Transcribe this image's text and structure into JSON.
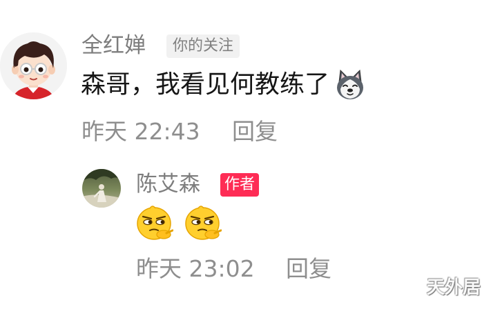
{
  "main_comment": {
    "username": "全红婵",
    "badge": "你的关注",
    "text": "森哥，我看见何教练了",
    "emoji_icon": "husky-dog-emoji-icon",
    "time": "昨天 22:43",
    "reply_label": "回复"
  },
  "reply_comment": {
    "username": "陈艾森",
    "badge": "作者",
    "emoji_icons": [
      "smug-face-emoji-icon",
      "smug-face-emoji-icon"
    ],
    "time": "昨天 23:02",
    "reply_label": "回复"
  },
  "watermark": "天外居",
  "colors": {
    "author_badge": "#fe2c55",
    "follow_badge_bg": "#f1f1f1",
    "secondary_text": "#8e8e8e",
    "primary_text": "#161616"
  }
}
